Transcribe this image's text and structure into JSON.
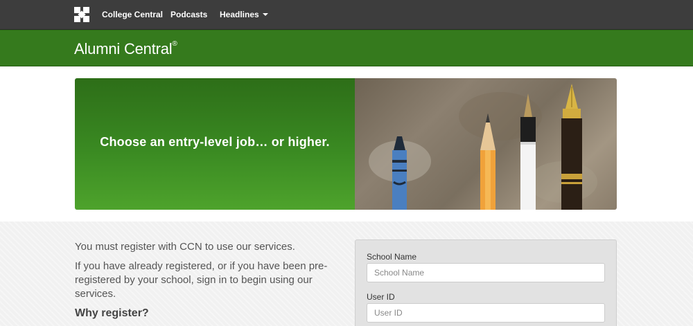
{
  "navbar": {
    "logo_icon": "college-central-logo-icon",
    "links": [
      {
        "label": "College Central"
      },
      {
        "label": "Podcasts"
      },
      {
        "label": "Headlines"
      }
    ]
  },
  "brand": {
    "title": "Alumni Central",
    "mark": "®"
  },
  "hero": {
    "tagline": "Choose an entry-level job… or higher."
  },
  "intro": {
    "line1": "You must register with CCN to use our services.",
    "line2": "If you have already registered, or if you have been pre-registered by your school, sign in to begin using our services.",
    "why_heading": "Why register?"
  },
  "login": {
    "school_label": "School Name",
    "school_placeholder": "School Name",
    "user_label": "User ID",
    "user_placeholder": "User ID"
  },
  "colors": {
    "navbar": "#3d3d3d",
    "brand_green": "#357a1d",
    "hero_green": "#3a8a22"
  }
}
